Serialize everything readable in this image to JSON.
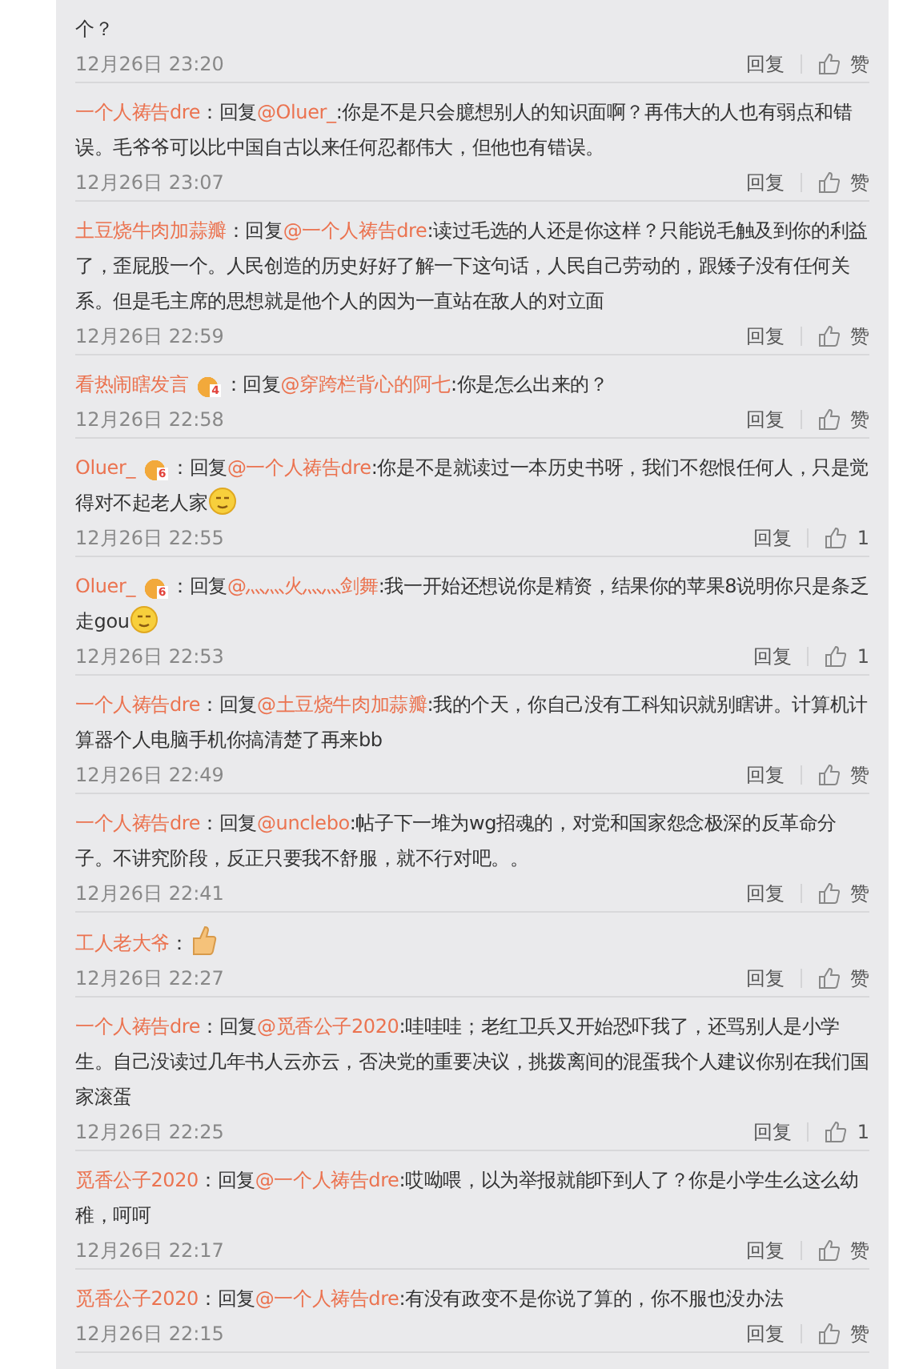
{
  "comments": [
    {
      "text": "个？",
      "time": "12月26日 23:20",
      "reply_label": "回复",
      "likes": "赞"
    },
    {
      "author": "一个人祷告dre",
      "separator": "：",
      "reply_prefix": "回复",
      "mention": "@Oluer_",
      "text": ":你是不是只会臆想别人的知识面啊？再伟大的人也有弱点和错误。毛爷爷可以比中国自古以来任何忍都伟大，但他也有错误。",
      "time": "12月26日 23:07",
      "reply_label": "回复",
      "likes": "赞"
    },
    {
      "author": "土豆烧牛肉加蒜瓣",
      "separator": "：",
      "reply_prefix": "回复",
      "mention": "@一个人祷告dre",
      "text": ":读过毛选的人还是你这样？只能说毛触及到你的利益了，歪屁股一个。人民创造的历史好好了解一下这句话，人民自己劳动的，跟矮子没有任何关系。但是毛主席的思想就是他个人的因为一直站在敌人的对立面",
      "time": "12月26日 22:59",
      "reply_label": "回复",
      "likes": "赞"
    },
    {
      "author": "看热闹瞎发言",
      "badge": "4",
      "separator": "：",
      "reply_prefix": "回复",
      "mention": "@穿跨栏背心的阿七",
      "text": ":你是怎么出来的？",
      "time": "12月26日 22:58",
      "reply_label": "回复",
      "likes": "赞"
    },
    {
      "author": "Oluer_",
      "badge": "6",
      "separator": "：",
      "reply_prefix": "回复",
      "mention": "@一个人祷告dre",
      "text": ":你是不是就读过一本历史书呀，我们不怨恨任何人，只是觉得对不起老人家",
      "emoji": {
        "kind": "face"
      },
      "time": "12月26日 22:55",
      "reply_label": "回复",
      "likes": "1"
    },
    {
      "author": "Oluer_",
      "badge": "6",
      "separator": "：",
      "reply_prefix": "回复",
      "mention": "@灬灬火灬灬剑舞",
      "text": ":我一开始还想说你是精资，结果你的苹果8说明你只是条乏走gou",
      "emoji": {
        "kind": "face"
      },
      "time": "12月26日 22:53",
      "reply_label": "回复",
      "likes": "1"
    },
    {
      "author": "一个人祷告dre",
      "separator": "：",
      "reply_prefix": "回复",
      "mention": "@土豆烧牛肉加蒜瓣",
      "text": ":我的个天，你自己没有工科知识就别瞎讲。计算机计算器个人电脑手机你搞清楚了再来bb",
      "time": "12月26日 22:49",
      "reply_label": "回复",
      "likes": "赞"
    },
    {
      "author": "一个人祷告dre",
      "separator": "：",
      "reply_prefix": "回复",
      "mention": "@unclebo",
      "text": ":帖子下一堆为wg招魂的，对党和国家怨念极深的反革命分子。不讲究阶段，反正只要我不舒服，就不行对吧。。",
      "time": "12月26日 22:41",
      "reply_label": "回复",
      "likes": "赞"
    },
    {
      "author": "工人老大爷",
      "separator": "：",
      "emoji": {
        "kind": "thumb"
      },
      "time": "12月26日 22:27",
      "reply_label": "回复",
      "likes": "赞"
    },
    {
      "author": "一个人祷告dre",
      "separator": "：",
      "reply_prefix": "回复",
      "mention": "@觅香公子2020",
      "text": ":哇哇哇；老红卫兵又开始恐吓我了，还骂别人是小学生。自己没读过几年书人云亦云，否决党的重要决议，挑拨离间的混蛋我个人建议你别在我们国家滚蛋",
      "time": "12月26日 22:25",
      "reply_label": "回复",
      "likes": "1"
    },
    {
      "author": "觅香公子2020",
      "separator": "：",
      "reply_prefix": "回复",
      "mention": "@一个人祷告dre",
      "text": ":哎呦喂，以为举报就能吓到人了？你是小学生么这么幼稚，呵呵",
      "time": "12月26日 22:17",
      "reply_label": "回复",
      "likes": "赞"
    },
    {
      "author": "觅香公子2020",
      "separator": "：",
      "reply_prefix": "回复",
      "mention": "@一个人祷告dre",
      "text": ":有没有政变不是你说了算的，你不服也没办法",
      "time": "12月26日 22:15",
      "reply_label": "回复",
      "likes": "赞"
    }
  ]
}
